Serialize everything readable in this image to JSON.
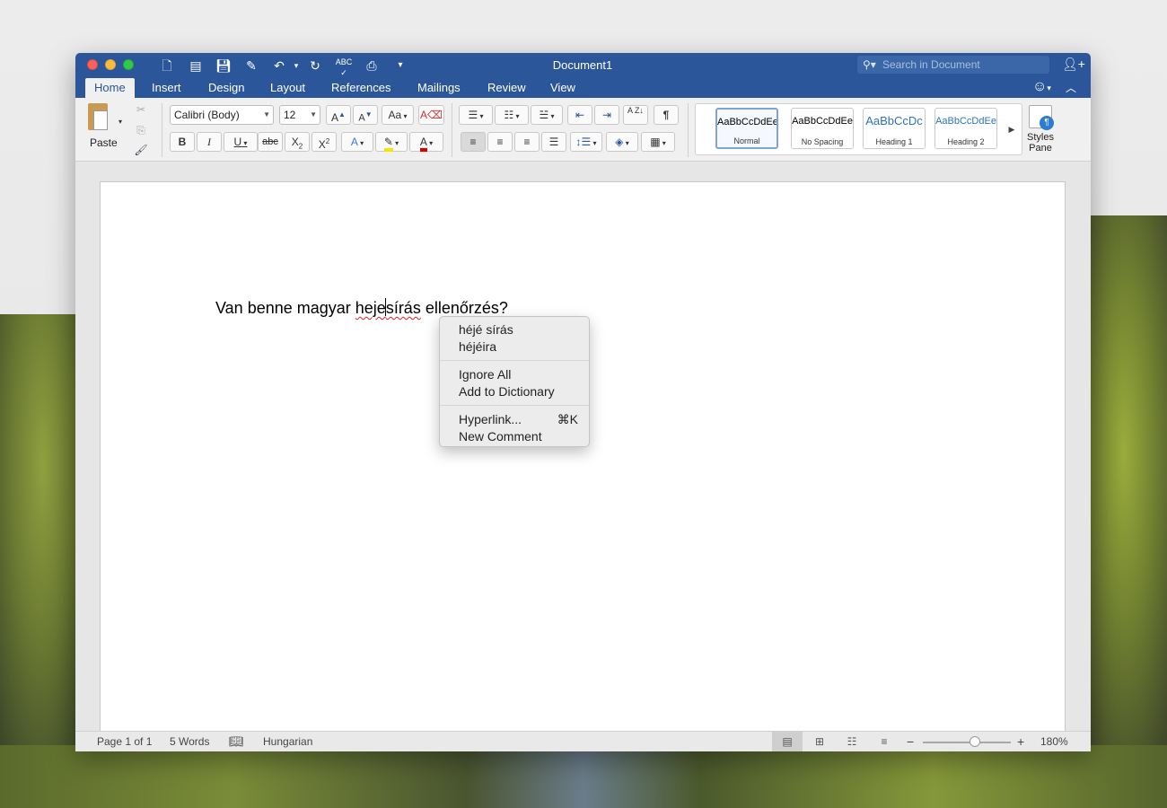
{
  "window": {
    "title": "Document1"
  },
  "quick_access": {
    "customize_icon": "chevron-down-icon"
  },
  "search": {
    "placeholder": "Search in Document"
  },
  "ribbon_tabs": [
    {
      "label": "Home",
      "active": true
    },
    {
      "label": "Insert"
    },
    {
      "label": "Design"
    },
    {
      "label": "Layout"
    },
    {
      "label": "References"
    },
    {
      "label": "Mailings"
    },
    {
      "label": "Review"
    },
    {
      "label": "View"
    }
  ],
  "clipboard": {
    "paste_label": "Paste"
  },
  "font": {
    "family": "Calibri (Body)",
    "size": "12",
    "grow": "A",
    "shrink": "A",
    "change_case": "Aa",
    "bold": "B",
    "italic": "I",
    "underline": "U",
    "strikethrough": "abc",
    "subscript": "X",
    "superscript": "X",
    "effects": "A",
    "font_color": "A",
    "highlight_color": "#f5e500",
    "font_color_value": "#e00000"
  },
  "paragraph": {
    "show_marks": "¶",
    "sort": "A Z"
  },
  "styles": [
    {
      "preview": "AaBbCcDdEe",
      "name": "Normal",
      "current": true,
      "color": "#000000"
    },
    {
      "preview": "AaBbCcDdEe",
      "name": "No Spacing",
      "color": "#000000"
    },
    {
      "preview": "AaBbCcDc",
      "name": "Heading 1",
      "color": "#2e74b5"
    },
    {
      "preview": "AaBbCcDdEe",
      "name": "Heading 2",
      "color": "#2e74b5"
    }
  ],
  "styles_pane": {
    "line1": "Styles",
    "line2": "Pane"
  },
  "document": {
    "before": "Van benne magyar ",
    "misspelled_part1": "heje",
    "misspelled_part2": "sírás",
    "after": " ellenőrzés?"
  },
  "context_menu": {
    "suggestions": [
      "héjé sírás",
      "héjéira"
    ],
    "ignore_all": "Ignore All",
    "add_to_dictionary": "Add to Dictionary",
    "hyperlink": "Hyperlink...",
    "hyperlink_shortcut": "⌘K",
    "new_comment": "New Comment"
  },
  "status_bar": {
    "page": "Page 1 of 1",
    "words": "5 Words",
    "language": "Hungarian",
    "zoom": "180%",
    "zoom_minus": "−",
    "zoom_plus": "+"
  }
}
